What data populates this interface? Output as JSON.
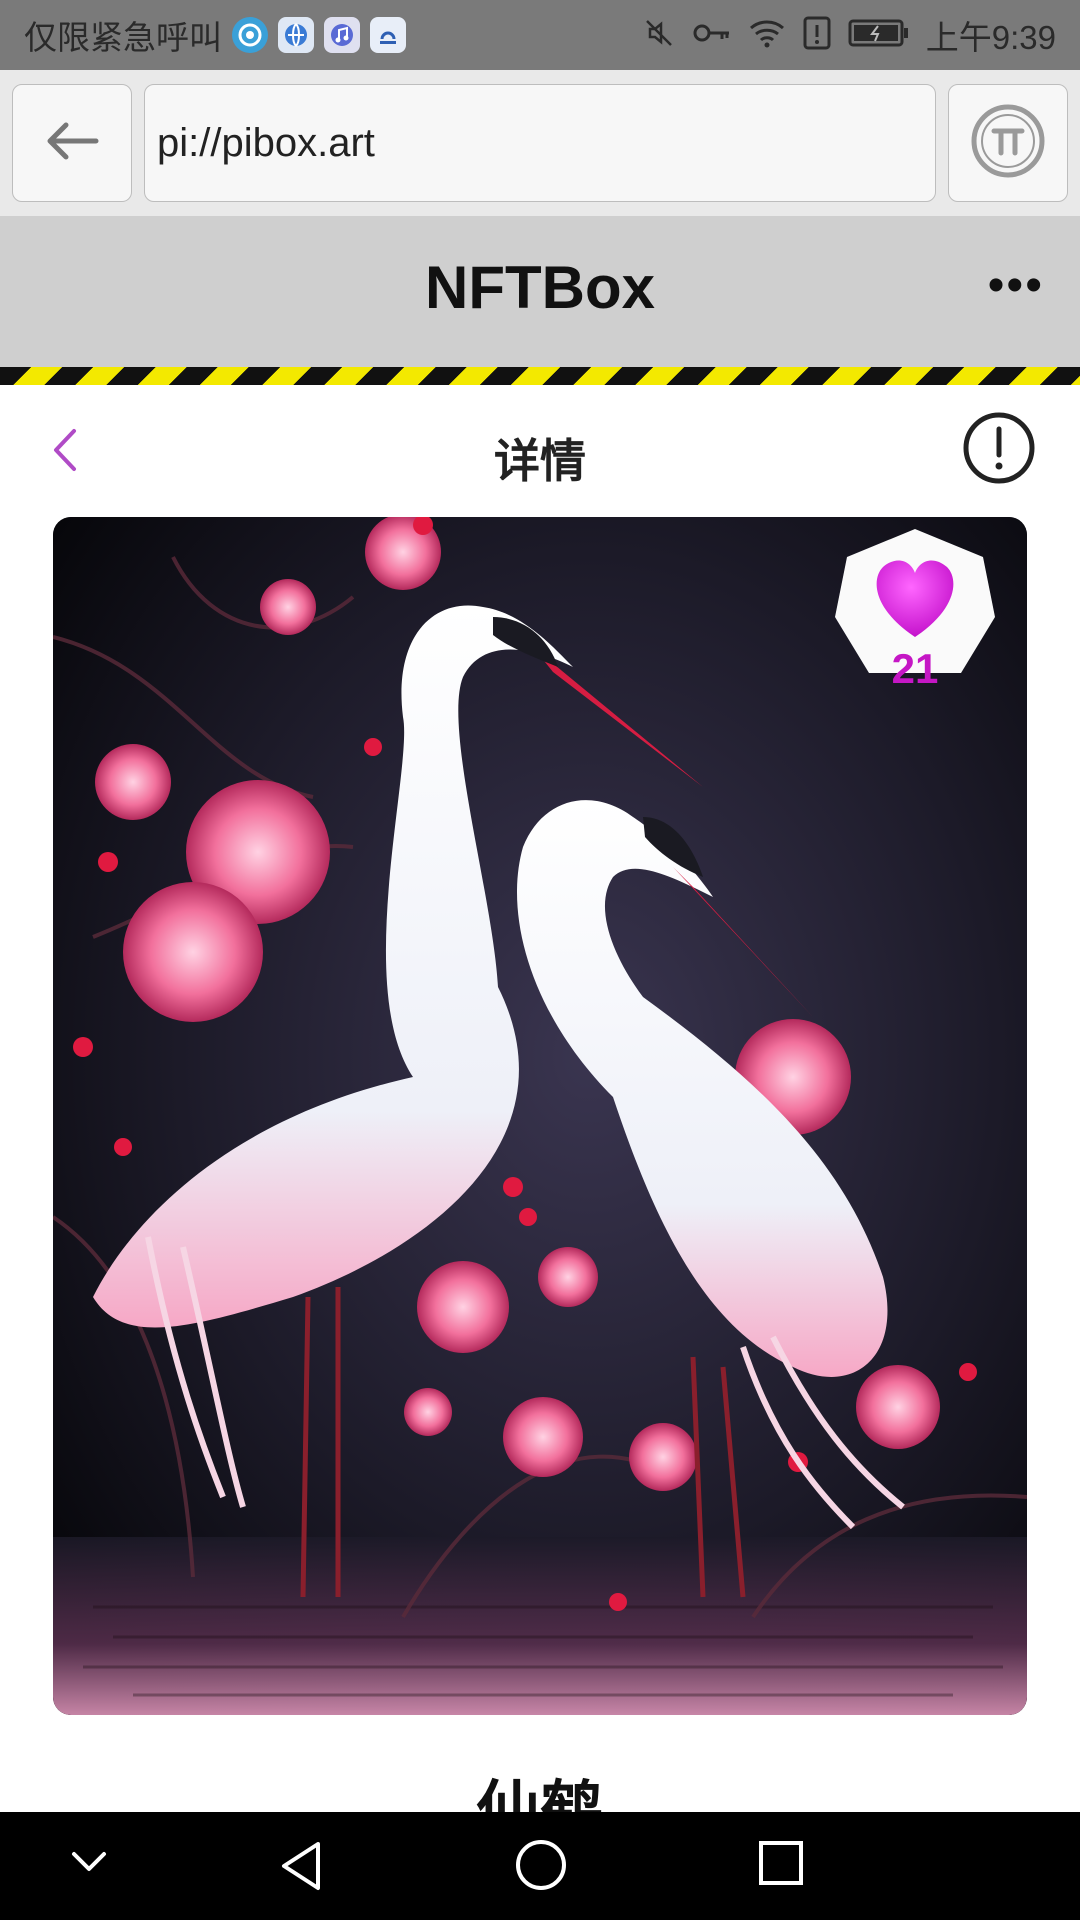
{
  "status_bar": {
    "carrier_text": "仅限紧急呼叫",
    "time": "上午9:39",
    "icons": [
      "weibo-icon",
      "browser-icon",
      "music-icon",
      "app-icon",
      "mute-icon",
      "key-icon",
      "wifi-icon",
      "alert-icon",
      "battery-icon"
    ]
  },
  "browser": {
    "url": "pi://pibox.art",
    "back_icon": "arrow-left-icon",
    "pi_icon": "pi-coin-icon"
  },
  "app_header": {
    "title": "NFTBox",
    "more_label": "•••"
  },
  "detail": {
    "title": "详情",
    "back_icon": "chevron-left-icon",
    "info_icon": "exclamation-circle-icon"
  },
  "artwork": {
    "like_count": "21",
    "title": "仙鹤"
  },
  "colors": {
    "accent": "#c517c5",
    "header_bg": "#cfcfcf",
    "hazard_yellow": "#f3e900"
  }
}
